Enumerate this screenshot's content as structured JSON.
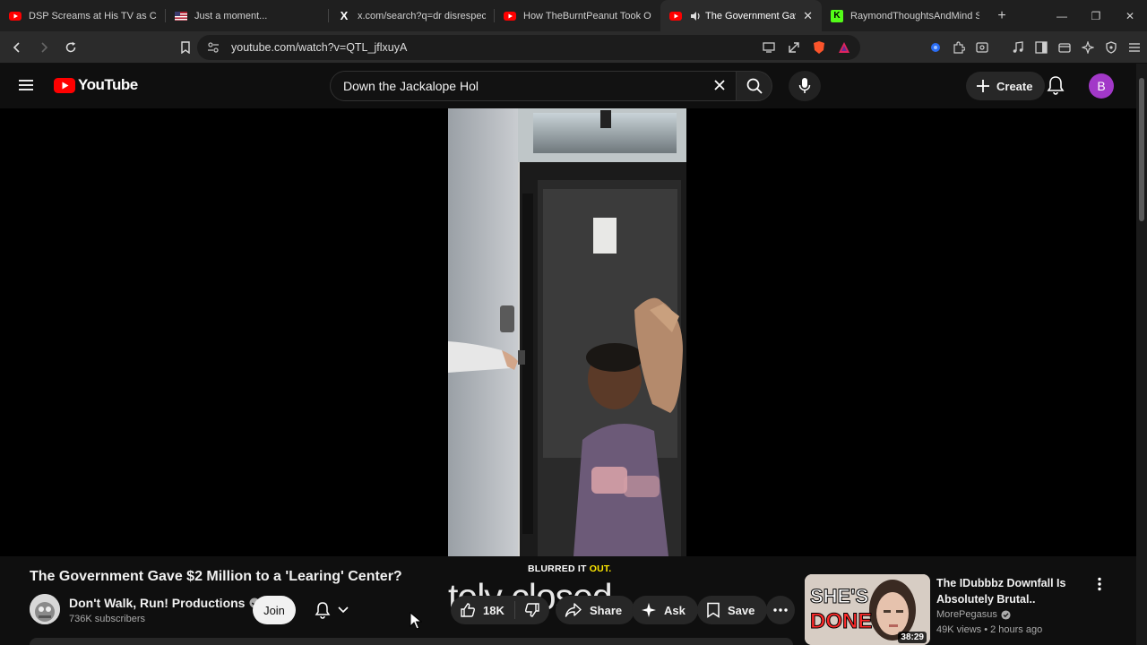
{
  "browser": {
    "tabs": [
      {
        "title": "DSP Screams at His TV as Call of",
        "favicon": "youtube-icon",
        "active": false
      },
      {
        "title": "Just a moment...",
        "favicon": "flag-icon",
        "active": false
      },
      {
        "title": "x.com/search?q=dr disrespect m",
        "favicon": "x-icon",
        "active": false
      },
      {
        "title": "How TheBurntPeanut Took Over",
        "favicon": "youtube-icon",
        "active": false
      },
      {
        "title": "The Government Gave $",
        "favicon": "youtube-icon",
        "active": true
      },
      {
        "title": "RaymondThoughtsAndMind Str",
        "favicon": "kick-icon",
        "active": false
      }
    ],
    "url": "youtube.com/watch?v=QTL_jflxuyA"
  },
  "youtube": {
    "logo_text": "YouTube",
    "search_value": "Down the Jackalope Hol",
    "create_label": "Create",
    "avatar_letter": "B",
    "accent": "#ff0000"
  },
  "video": {
    "caption_small_white": "BLURRED IT ",
    "caption_small_yellow": "OUT.",
    "caption_big": "tely closed",
    "title": "The Government Gave $2 Million to a 'Learing' Center?"
  },
  "channel": {
    "name": "Don't Walk, Run! Productions",
    "subscribers": "736K subscribers",
    "join_label": "Join"
  },
  "actions": {
    "likes": "18K",
    "share_label": "Share",
    "ask_label": "Ask",
    "save_label": "Save"
  },
  "recommendation": {
    "title": "The IDubbbz Downfall Is Absolutely Brutal..",
    "channel": "MorePegasus",
    "meta": "49K views • 2 hours ago",
    "duration": "38:29",
    "thumb_text_1": "SHE'S",
    "thumb_text_2": "DONE"
  }
}
